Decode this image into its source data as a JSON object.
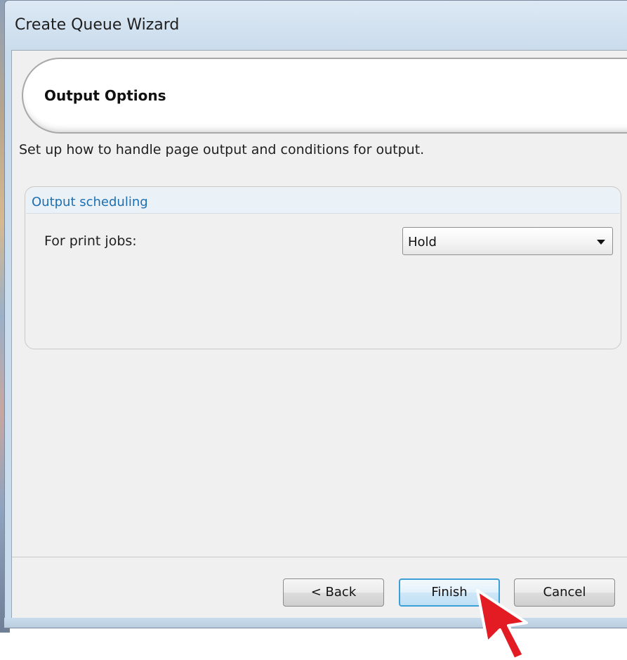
{
  "window": {
    "title": "Create Queue Wizard"
  },
  "page": {
    "heading": "Output Options",
    "description": "Set up how to handle page output and conditions for output."
  },
  "output_scheduling": {
    "group_title": "Output scheduling",
    "print_jobs_label": "For print jobs:",
    "print_jobs_value": "Hold"
  },
  "buttons": {
    "back": "< Back",
    "finish": "Finish",
    "cancel": "Cancel"
  },
  "annotation": {
    "pointer_color": "#e31b23",
    "pointer_icon": "arrow-pointer-icon"
  },
  "colors": {
    "group_title": "#1e6fb0",
    "focus_border": "#3c9fd8"
  }
}
